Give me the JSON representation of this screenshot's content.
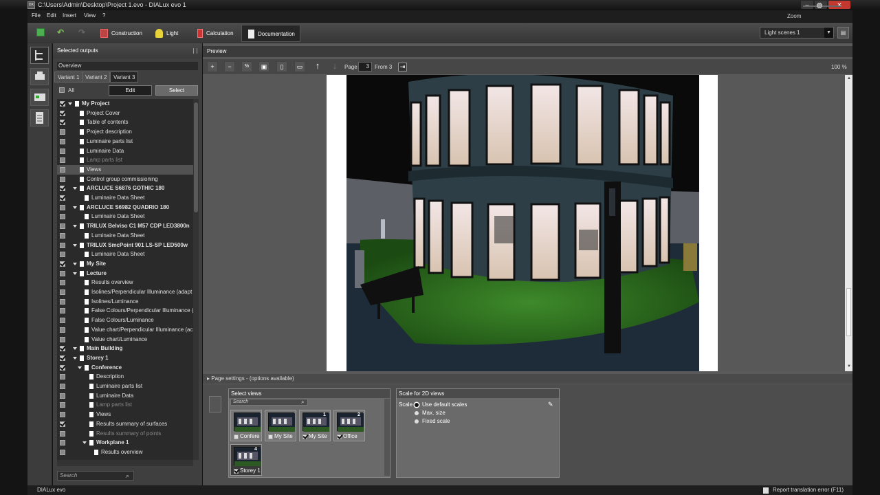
{
  "window": {
    "title": "C:\\Users\\Admin\\Desktop\\Project 1.evo - DIALux evo 1",
    "logo": "DX"
  },
  "menu": {
    "items": [
      "File",
      "Edit",
      "Insert",
      "View",
      "?"
    ],
    "zoom_label": "Zoom"
  },
  "toolbar": {
    "tabs": [
      {
        "label": "Construction",
        "icon": "construction-icon"
      },
      {
        "label": "Light",
        "icon": "light-icon"
      },
      {
        "label": "Calculation",
        "icon": "calculation-icon"
      },
      {
        "label": "Documentation",
        "icon": "documentation-icon",
        "active": true
      }
    ],
    "light_scene": "Light scenes 1"
  },
  "left": {
    "title": "Selected outputs",
    "overview": "Overview",
    "variants": [
      "Variant 1",
      "Variant 2",
      "Variant 3"
    ],
    "all_label": "All",
    "edit_label": "Edit",
    "select_label": "Select",
    "search_placeholder": "Search",
    "tree": [
      {
        "label": "My Project",
        "level": 0,
        "checked": true,
        "bold": true,
        "expand": true
      },
      {
        "label": "Project Cover",
        "level": 1,
        "checked": true
      },
      {
        "label": "Table of contents",
        "level": 1,
        "checked": true
      },
      {
        "label": "Project description",
        "level": 1,
        "checked": false
      },
      {
        "label": "Luminaire parts list",
        "level": 1,
        "checked": false
      },
      {
        "label": "Luminaire Data",
        "level": 1,
        "checked": false
      },
      {
        "label": "Lamp parts list",
        "level": 1,
        "checked": false,
        "dim": true
      },
      {
        "label": "Views",
        "level": 1,
        "checked": false,
        "selected": true
      },
      {
        "label": "Control group commissioning",
        "level": 1,
        "checked": false
      },
      {
        "label": "ARCLUCE S6876 GOTHIC 180",
        "level": 1,
        "checked": true,
        "bold": true,
        "expand": true
      },
      {
        "label": "Luminaire Data Sheet",
        "level": 2,
        "checked": true
      },
      {
        "label": "ARCLUCE S6982 QUADRIO 180",
        "level": 1,
        "checked": false,
        "bold": true,
        "expand": true
      },
      {
        "label": "Luminaire Data Sheet",
        "level": 2,
        "checked": false
      },
      {
        "label": "TRILUX Belviso C1 M57 CDP LED3800n",
        "level": 1,
        "checked": false,
        "bold": true,
        "expand": true
      },
      {
        "label": "Luminaire Data Sheet",
        "level": 2,
        "checked": false
      },
      {
        "label": "TRILUX SmcPoint 901 LS-SP LED500w",
        "level": 1,
        "checked": false,
        "bold": true,
        "expand": true
      },
      {
        "label": "Luminaire Data Sheet",
        "level": 2,
        "checked": false
      },
      {
        "label": "My Site",
        "level": 1,
        "checked": true,
        "bold": true,
        "expand": true
      },
      {
        "label": "Lecture",
        "level": 1,
        "checked": false,
        "bold": true,
        "expand": true
      },
      {
        "label": "Results overview",
        "level": 2,
        "checked": false
      },
      {
        "label": "Isolines/Perpendicular Illuminance (adapt",
        "level": 2,
        "checked": false
      },
      {
        "label": "Isolines/Luminance",
        "level": 2,
        "checked": false
      },
      {
        "label": "False Colours/Perpendicular Illuminance (",
        "level": 2,
        "checked": false
      },
      {
        "label": "False Colours/Luminance",
        "level": 2,
        "checked": false
      },
      {
        "label": "Value chart/Perpendicular Illuminance (ac",
        "level": 2,
        "checked": false
      },
      {
        "label": "Value chart/Luminance",
        "level": 2,
        "checked": false
      },
      {
        "label": "Main Building",
        "level": 1,
        "checked": true,
        "bold": true,
        "expand": true
      },
      {
        "label": "Storey 1",
        "level": 1,
        "checked": true,
        "bold": true,
        "expand": true
      },
      {
        "label": "Conference",
        "level": 2,
        "checked": true,
        "bold": true,
        "expand": true
      },
      {
        "label": "Description",
        "level": 3,
        "checked": false
      },
      {
        "label": "Luminaire parts list",
        "level": 3,
        "checked": false
      },
      {
        "label": "Luminaire Data",
        "level": 3,
        "checked": false
      },
      {
        "label": "Lamp parts list",
        "level": 3,
        "checked": false,
        "dim": true
      },
      {
        "label": "Views",
        "level": 3,
        "checked": false
      },
      {
        "label": "Results summary of surfaces",
        "level": 3,
        "checked": true
      },
      {
        "label": "Results summary of points",
        "level": 3,
        "checked": false,
        "dim": true
      },
      {
        "label": "Workplane 1",
        "level": 3,
        "checked": false,
        "bold": true,
        "expand": true
      },
      {
        "label": "Results overview",
        "level": 4,
        "checked": false
      }
    ]
  },
  "preview": {
    "title": "Preview",
    "page_label": "Page",
    "page_number": "3",
    "from_label": "From 3",
    "zoom_percent": "100 %"
  },
  "page_settings": {
    "label": "Page settings - (options available)"
  },
  "select_views": {
    "title": "Select views",
    "search_placeholder": "Search",
    "thumbs": [
      {
        "label": "Confere",
        "checked": false,
        "num": ""
      },
      {
        "label": "My Site",
        "checked": false,
        "num": ""
      },
      {
        "label": "My Site",
        "checked": true,
        "num": "1"
      },
      {
        "label": "Office",
        "checked": true,
        "num": "2"
      },
      {
        "label": "Storey 1",
        "checked": true,
        "num": "4",
        "selected": true
      }
    ]
  },
  "scale_2d": {
    "title": "Scale for 2D views",
    "scale_label": "Scale",
    "options": [
      {
        "label": "Use default scales",
        "selected": true
      },
      {
        "label": "Max. size",
        "selected": false
      },
      {
        "label": "Fixed scale",
        "selected": false
      }
    ]
  },
  "status": {
    "app_name": "DIALux evo",
    "report_label": "Report translation error (F11)"
  }
}
